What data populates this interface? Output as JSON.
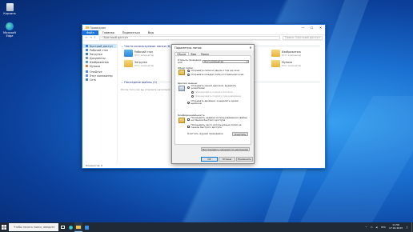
{
  "colors": {
    "accent": "#0078d7",
    "folder": "#f1c14b",
    "taskbar": "#1f2a36"
  },
  "desktop": {
    "icons": [
      {
        "label": "Корзина",
        "icon": "recycle-bin-icon"
      },
      {
        "label": "Microsoft Edge",
        "icon": "edge-icon"
      }
    ]
  },
  "explorer": {
    "title": "Проводник",
    "window_buttons": [
      "—",
      "☐",
      "✕"
    ],
    "ribbon_tabs": [
      "Файл",
      "Главная",
      "Поделиться",
      "Вид"
    ],
    "address": "› Быстрый доступ",
    "search_placeholder": "Поиск: Быстрый доступ",
    "sidebar": [
      {
        "label": "Быстрый доступ",
        "icon": "star-icon",
        "color": "#3b7ddc"
      },
      {
        "label": "Рабочий стол",
        "icon": "desktop-icon",
        "color": "#3a8ee6"
      },
      {
        "label": "Загрузки",
        "icon": "download-icon",
        "color": "#2c79d4"
      },
      {
        "label": "Документы",
        "icon": "document-icon",
        "color": "#7b8ea8"
      },
      {
        "label": "Изображения",
        "icon": "pictures-icon",
        "color": "#4aa0e0"
      },
      {
        "label": "Музыка",
        "icon": "music-icon",
        "color": "#e07b39"
      },
      {
        "label": "OneDrive",
        "icon": "cloud-icon",
        "color": "#3e8fe4"
      },
      {
        "label": "Этот компьютер",
        "icon": "computer-icon",
        "color": "#5b95d6"
      },
      {
        "label": "Сеть",
        "icon": "network-icon",
        "color": "#4d87c7"
      }
    ],
    "groups": [
      {
        "label": "Часто используемые папки (6)"
      },
      {
        "label": "Последние файлы (0)"
      }
    ],
    "folders": [
      {
        "name": "Рабочий стол",
        "sub": "Этот компьютер"
      },
      {
        "name": "Загрузки",
        "sub": "Этот компьютер"
      },
      {
        "name": "Изображения",
        "sub": "Этот компьютер"
      },
      {
        "name": "Музыка",
        "sub": "Этот компьютер"
      }
    ],
    "hidden_text": "После того как вы откроете несколько файлов, они будут отображаться здесь.",
    "status": "Элементов: 6"
  },
  "dialog": {
    "title": "Параметры папок",
    "tabs": [
      "Общие",
      "Вид",
      "Поиск"
    ],
    "open_label": "Открыть проводник для:",
    "open_value": "Этот компьютер",
    "browse_title": "Обзор папок",
    "browse_opts": [
      "Открывать папки в одном и том же окне",
      "Открывать каждую папку в отдельном окне"
    ],
    "click_title": "Щелчки мышью",
    "click_opts": [
      "Открывать одним щелчком, выделять указателем",
      "Подчеркивать подписи значков",
      "Подчеркивать подписи при наведении",
      "Открывать двойным, а выделять одним щелчком"
    ],
    "privacy_title": "Конфиденциальность",
    "privacy_opts": [
      "Показывать недавно использовавшиеся файлы на панели быстрого доступа",
      "Показывать часто используемые папки на панели быстрого доступа"
    ],
    "clear_label": "Очистить журнал проводника",
    "clear_btn": "Очистить",
    "restore_btn": "Восстановить значения по умолчанию",
    "ok": "ОК",
    "cancel": "Отмена",
    "apply": "Применить"
  },
  "taskbar": {
    "search_placeholder": "Чтобы начать поиск, введите здесь запрос",
    "apps": [
      "task-view-icon",
      "edge-icon",
      "explorer-icon",
      "store-icon"
    ],
    "lang": "РУС",
    "time": "11:56",
    "date": "17.02.2025"
  }
}
